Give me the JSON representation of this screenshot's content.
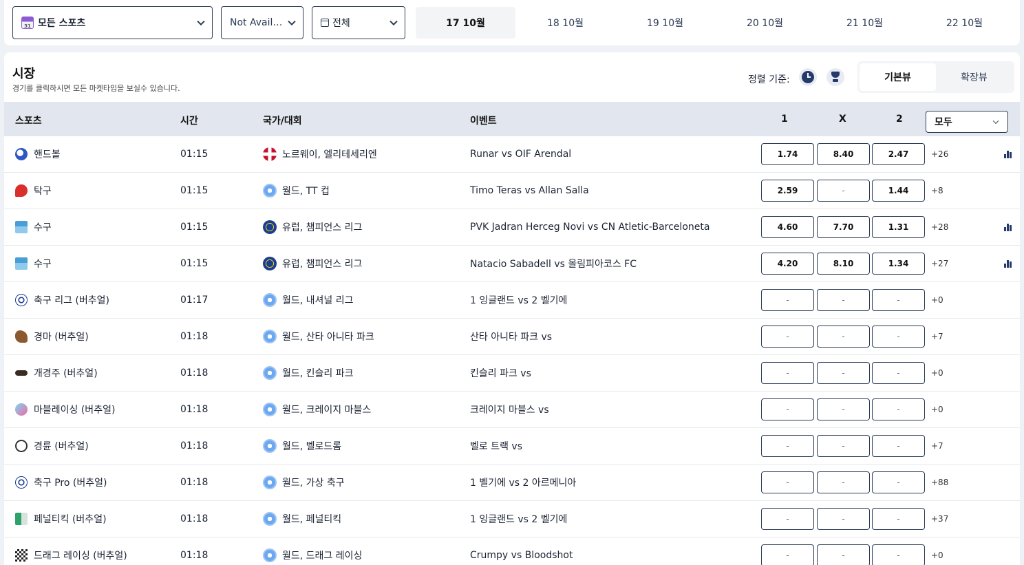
{
  "filters": {
    "sport_label": "모든 스포츠",
    "availability_label": "Not Avail…",
    "period_label": "전체"
  },
  "dates": [
    "17 10월",
    "18 10월",
    "19 10월",
    "20 10월",
    "21 10월",
    "22 10월"
  ],
  "active_date_index": 0,
  "market": {
    "title": "시장",
    "subtitle": "경기를 클릭하시면 모든 마켓타입을 보실수 있습니다.",
    "sort_label": "정렬 기준:",
    "views": [
      "기본뷰",
      "확장뷰"
    ],
    "active_view_index": 0
  },
  "table": {
    "headers": {
      "sport": "스포츠",
      "time": "시간",
      "competition": "국가/대회",
      "event": "이벤트",
      "odd1": "1",
      "oddx": "X",
      "odd2": "2",
      "filter": "모두"
    },
    "rows": [
      {
        "sport": "핸드볼",
        "icon": "handball-icon",
        "time": "01:15",
        "flag": "norway-flag-icon",
        "competition": "노르웨이, 엘리테세리엔",
        "event": "Runar vs OIF Arendal",
        "odd1": "1.74",
        "oddx": "8.40",
        "odd2": "2.47",
        "more": "+26",
        "stats": true
      },
      {
        "sport": "탁구",
        "icon": "table-tennis-icon",
        "time": "01:15",
        "flag": "world-icon",
        "competition": "월드, TT 컵",
        "event": "Timo Teras vs Allan Salla",
        "odd1": "2.59",
        "oddx": "-",
        "odd2": "1.44",
        "more": "+8",
        "stats": false
      },
      {
        "sport": "수구",
        "icon": "water-polo-icon",
        "time": "01:15",
        "flag": "europe-flag-icon",
        "competition": "유럽, 챔피언스 리그",
        "event": "PVK Jadran Herceg Novi vs CN Atletic-Barceloneta",
        "odd1": "4.60",
        "oddx": "7.70",
        "odd2": "1.31",
        "more": "+28",
        "stats": true
      },
      {
        "sport": "수구",
        "icon": "water-polo-icon",
        "time": "01:15",
        "flag": "europe-flag-icon",
        "competition": "유럽, 챔피언스 리그",
        "event": "Natacio Sabadell vs 올림피아코스 FC",
        "odd1": "4.20",
        "oddx": "8.10",
        "odd2": "1.34",
        "more": "+27",
        "stats": true
      },
      {
        "sport": "축구 리그 (버추얼)",
        "icon": "soccer-ball-icon",
        "time": "01:17",
        "flag": "world-icon",
        "competition": "월드, 내셔널 리그",
        "event": "1 잉글랜드 vs 2 벨기에",
        "odd1": "-",
        "oddx": "-",
        "odd2": "-",
        "more": "+0",
        "stats": false
      },
      {
        "sport": "경마 (버추얼)",
        "icon": "horse-racing-icon",
        "time": "01:18",
        "flag": "world-icon",
        "competition": "월드, 산타 아니타 파크",
        "event": "산타 아니타 파크 vs",
        "odd1": "-",
        "oddx": "-",
        "odd2": "-",
        "more": "+7",
        "stats": false
      },
      {
        "sport": "개경주 (버추얼)",
        "icon": "greyhound-icon",
        "time": "01:18",
        "flag": "world-icon",
        "competition": "월드, 킨슬리 파크",
        "event": "킨슬리 파크 vs",
        "odd1": "-",
        "oddx": "-",
        "odd2": "-",
        "more": "+0",
        "stats": false
      },
      {
        "sport": "마블레이싱 (버추얼)",
        "icon": "marble-racing-icon",
        "time": "01:18",
        "flag": "world-icon",
        "competition": "월드, 크레이지 마블스",
        "event": "크레이지 마블스 vs",
        "odd1": "-",
        "oddx": "-",
        "odd2": "-",
        "more": "+0",
        "stats": false
      },
      {
        "sport": "경륜 (버추얼)",
        "icon": "bicycle-icon",
        "time": "01:18",
        "flag": "world-icon",
        "competition": "월드, 벨로드롬",
        "event": "벨로 트랙 vs",
        "odd1": "-",
        "oddx": "-",
        "odd2": "-",
        "more": "+7",
        "stats": false
      },
      {
        "sport": "축구 Pro (버추얼)",
        "icon": "soccer-ball-icon",
        "time": "01:18",
        "flag": "world-icon",
        "competition": "월드, 가상 축구",
        "event": "1 벨기에 vs 2 아르메니아",
        "odd1": "-",
        "oddx": "-",
        "odd2": "-",
        "more": "+88",
        "stats": false
      },
      {
        "sport": "페널티킥 (버추얼)",
        "icon": "penalty-kick-icon",
        "time": "01:18",
        "flag": "world-icon",
        "competition": "월드, 페널티킥",
        "event": "1 잉글랜드 vs 2 벨기에",
        "odd1": "-",
        "oddx": "-",
        "odd2": "-",
        "more": "+37",
        "stats": false
      },
      {
        "sport": "드래그 레이싱 (버추얼)",
        "icon": "checkered-flag-icon",
        "time": "01:18",
        "flag": "world-icon",
        "competition": "월드, 드래그 레이싱",
        "event": "Crumpy vs Bloodshot",
        "odd1": "-",
        "oddx": "-",
        "odd2": "-",
        "more": "+0",
        "stats": false
      }
    ]
  }
}
